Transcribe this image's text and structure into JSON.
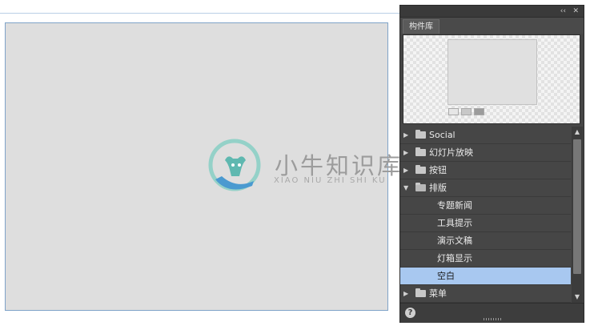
{
  "watermark": {
    "text": "小牛知识库",
    "subtext": "XIAO NIU ZHI SHI KU"
  },
  "panel": {
    "tab_label": "构件库",
    "controls": {
      "collapse": "‹‹",
      "close": "✕"
    },
    "tree": [
      {
        "label": "Social",
        "expanded": false,
        "type": "folder"
      },
      {
        "label": "幻灯片放映",
        "expanded": false,
        "type": "folder"
      },
      {
        "label": "按钮",
        "expanded": false,
        "type": "folder"
      },
      {
        "label": "排版",
        "expanded": true,
        "type": "folder"
      },
      {
        "label": "专题新闻",
        "type": "item"
      },
      {
        "label": "工具提示",
        "type": "item"
      },
      {
        "label": "演示文稿",
        "type": "item"
      },
      {
        "label": "灯箱显示",
        "type": "item"
      },
      {
        "label": "空白",
        "type": "item",
        "selected": true
      },
      {
        "label": "菜单",
        "expanded": false,
        "type": "folder"
      }
    ],
    "help": "?"
  },
  "colors": {
    "panel_bg": "#464646",
    "selection": "#a8c8f0",
    "canvas": "#dedede",
    "logo_teal": "#5fb8b0",
    "logo_blue": "#4a8fc8"
  }
}
